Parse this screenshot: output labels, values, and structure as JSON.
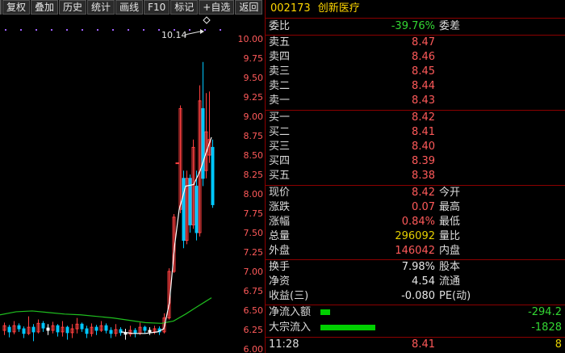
{
  "toolbar": {
    "items": [
      "复权",
      "叠加",
      "历史",
      "统计",
      "画线",
      "F10",
      "标记",
      "+自选",
      "返回"
    ]
  },
  "chart": {
    "price_labels": [
      "10.00",
      "9.75",
      "9.50",
      "9.25",
      "9.00",
      "8.75",
      "8.50",
      "8.25",
      "8.00",
      "7.75",
      "7.50",
      "7.25",
      "7.00",
      "6.75",
      "6.50",
      "6.25",
      "6.00"
    ],
    "high_label": "10.14",
    "colors": {
      "up": "#ff4040",
      "down": "#00c8ff",
      "ma_white": "#ffffff",
      "ma_green": "#1fbf1f",
      "dot": "#a060ff"
    }
  },
  "quote": {
    "code": "002173",
    "name": "创新医疗",
    "weibi": {
      "label": "委比",
      "value": "-39.76%",
      "label2": "委差"
    },
    "sell": [
      {
        "label": "卖五",
        "price": "8.47"
      },
      {
        "label": "卖四",
        "price": "8.46"
      },
      {
        "label": "卖三",
        "price": "8.45"
      },
      {
        "label": "卖二",
        "price": "8.44"
      },
      {
        "label": "卖一",
        "price": "8.43"
      }
    ],
    "buy": [
      {
        "label": "买一",
        "price": "8.42"
      },
      {
        "label": "买二",
        "price": "8.41"
      },
      {
        "label": "买三",
        "price": "8.40"
      },
      {
        "label": "买四",
        "price": "8.39"
      },
      {
        "label": "买五",
        "price": "8.38"
      }
    ],
    "stats1": [
      {
        "label": "现价",
        "value": "8.42",
        "label2": "今开"
      },
      {
        "label": "涨跌",
        "value": "0.07",
        "label2": "最高"
      },
      {
        "label": "涨幅",
        "value": "0.84%",
        "label2": "最低"
      },
      {
        "label": "总量",
        "value": "296092",
        "label2": "量比"
      },
      {
        "label": "外盘",
        "value": "146042",
        "label2": "内盘"
      }
    ],
    "stats2": [
      {
        "label": "换手",
        "value": "7.98%",
        "label2": "股本"
      },
      {
        "label": "净资",
        "value": "4.54",
        "label2": "流通"
      },
      {
        "label": "收益(三)",
        "value": "-0.080",
        "label2": "PE(动)"
      }
    ],
    "flows": [
      {
        "label": "净流入额",
        "value": "-294.2",
        "bar_fraction": 0.06
      },
      {
        "label": "大宗流入",
        "value": "-1828",
        "bar_fraction": 0.35
      }
    ],
    "tick": {
      "time": "11:28",
      "price": "8.41",
      "volume": "8"
    }
  }
}
